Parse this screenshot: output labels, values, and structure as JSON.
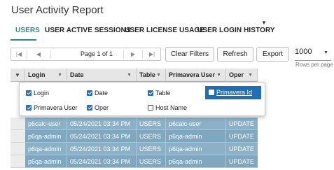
{
  "page": {
    "title": "User Activity Report"
  },
  "tabs": [
    {
      "label": "USERS",
      "active": true
    },
    {
      "label": "USER ACTIVE SESSIONS",
      "active": false
    },
    {
      "label": "USER LICENSE USAGE",
      "active": false
    },
    {
      "label": "USER LOGIN HISTORY",
      "active": false
    }
  ],
  "pager": {
    "label": "Page 1 of 1",
    "first_icon": "first-page-icon",
    "prev_icon": "prev-page-icon",
    "next_icon": "next-page-icon",
    "last_icon": "last-page-icon"
  },
  "toolbar": {
    "clear_filters": "Clear Filters",
    "refresh": "Refresh",
    "export": "Export",
    "rows_per_page_value": "1000",
    "rows_per_page_label": "Rows per page"
  },
  "grid": {
    "columns": [
      "Login",
      "Date",
      "Table",
      "Primavera User",
      "Oper"
    ],
    "rows": [
      [
        "p6calc-user",
        "05/24/2021 03:34 PM",
        "USERS",
        "p6calc-user",
        "UPDATE"
      ],
      [
        "p6qa-admin",
        "05/24/2021 03:34 PM",
        "USERS",
        "p6qa-admin",
        "UPDATE"
      ],
      [
        "p6qa-admin",
        "05/24/2021 03:34 PM",
        "USERS",
        "p6qa-admin",
        "UPDATE"
      ],
      [
        "p6qa-admin",
        "05/24/2021 03:34 PM",
        "USERS",
        "p6qa-admin",
        "UPDATE"
      ]
    ],
    "selected_row_color": "#8cb1c7"
  },
  "column_chooser": {
    "options": [
      {
        "label": "Login",
        "checked": true
      },
      {
        "label": "Date",
        "checked": true
      },
      {
        "label": "Table",
        "checked": true
      },
      {
        "label": "Primavera Id",
        "checked": false,
        "highlighted": true
      },
      {
        "label": "Primavera User",
        "checked": true
      },
      {
        "label": "Oper",
        "checked": true
      },
      {
        "label": "Host Name",
        "checked": false
      }
    ]
  },
  "colors": {
    "accent": "#2a8c82",
    "highlight": "#1e6fb8"
  }
}
